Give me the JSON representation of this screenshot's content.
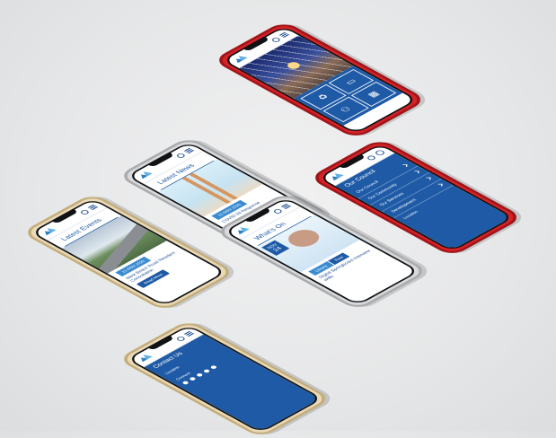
{
  "phones": {
    "home": {
      "services": [
        "recycle-icon",
        "computer-icon",
        "community-icon",
        "calendar-icon"
      ]
    },
    "news": {
      "heading": "Latest News",
      "date": "21 NOV 2020",
      "headline": "COVID-19 Response",
      "button": "Read More"
    },
    "menu": {
      "heading": "Our Council",
      "items": [
        "Our Council",
        "Our Community",
        "Our Services",
        "Development"
      ],
      "location_label": "Location"
    },
    "events": {
      "heading": "Latest Events",
      "date": "21 NOV 2020",
      "headline": "West Beach Road Resident Consultation",
      "button": "Read More"
    },
    "whatson": {
      "heading": "What's On",
      "date_month": "NOV",
      "date_day": "24",
      "tag": "Library",
      "tag2": "Free",
      "headline": "Digital Springboard Interview skills"
    },
    "contact": {
      "heading": "Contact Us",
      "location_label": "Location",
      "connect_label": "Connect"
    }
  }
}
